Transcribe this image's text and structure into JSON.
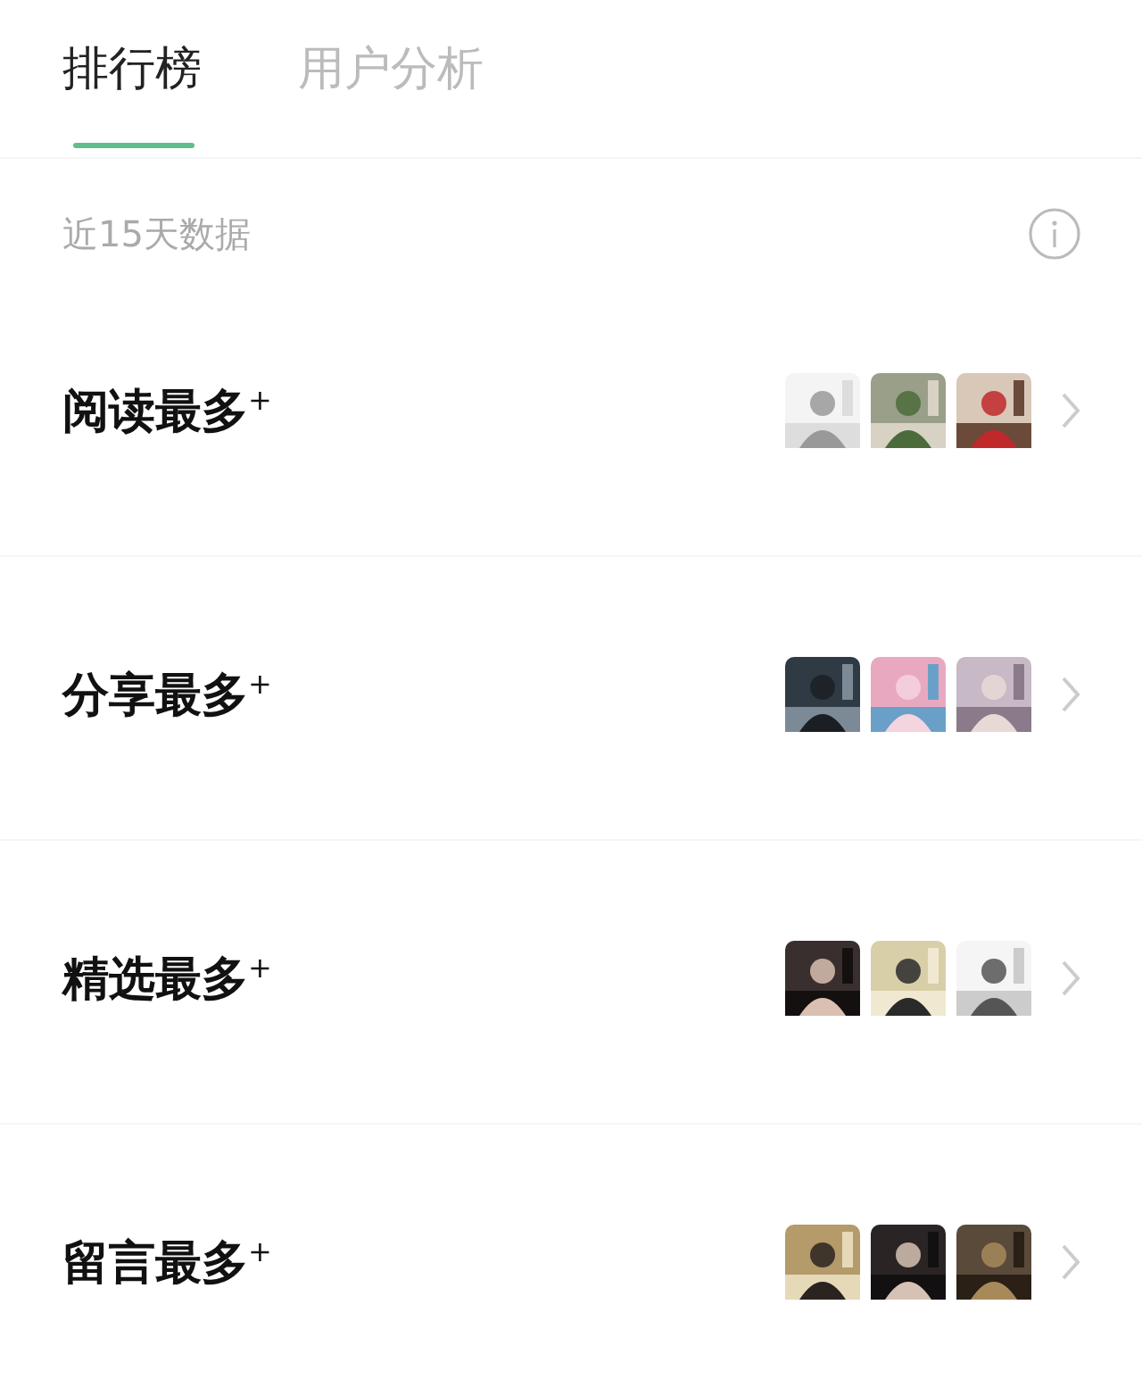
{
  "tabs": [
    {
      "label": "排行榜",
      "selected": true
    },
    {
      "label": "用户分析",
      "selected": false
    }
  ],
  "subtitle": "近15天数据",
  "rankings": [
    {
      "title": "阅读最多$^{+}$"
    },
    {
      "title": "分享最多$^{+}$"
    },
    {
      "title": "精选最多$^{+}$"
    },
    {
      "title": "留言最多$^{+}$"
    }
  ]
}
